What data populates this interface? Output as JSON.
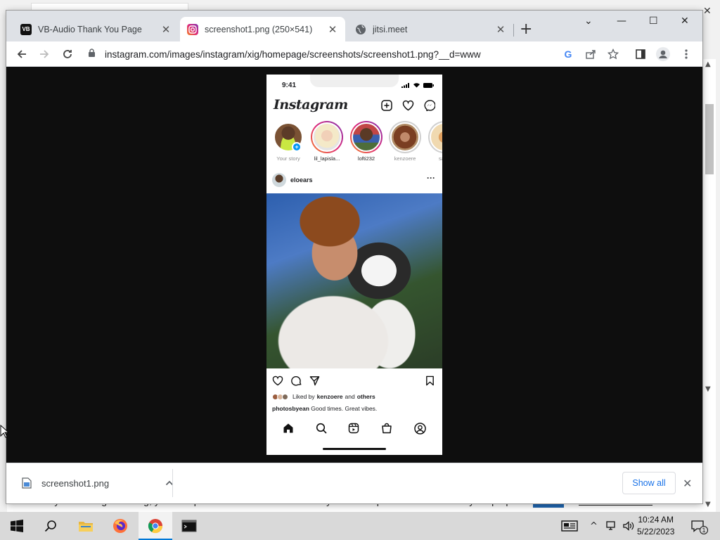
{
  "background": {
    "cookie_text": "By continuing browsing, you accept cookies we use to enhance your site experience and for analytics purposes.",
    "ok_label": "OK",
    "more_info_label": "More information"
  },
  "browser": {
    "tabs": [
      {
        "title": "VB-Audio Thank You Page",
        "icon": "vb-audio-icon",
        "active": false
      },
      {
        "title": "screenshot1.png (250×541)",
        "icon": "instagram-icon",
        "active": true
      },
      {
        "title": "jitsi.meet",
        "icon": "globe-icon",
        "active": false
      }
    ],
    "url": "instagram.com/images/instagram/xig/homepage/screenshots/screenshot1.png?__d=www"
  },
  "phone": {
    "time": "9:41",
    "logo": "Instagram",
    "stories": [
      {
        "name": "Your story",
        "own": true
      },
      {
        "name": "lil_lapisla...",
        "own": false
      },
      {
        "name": "lofti232",
        "own": false
      },
      {
        "name": "kenzoere",
        "own": false
      },
      {
        "name": "sapp",
        "own": false
      }
    ],
    "post": {
      "username": "eloears",
      "likes_prefix": "Liked by",
      "likes_user": "kenzoere",
      "likes_and": "and",
      "likes_others": "others",
      "caption_user": "photosbyean",
      "caption_text": "Good times. Great vibes."
    }
  },
  "downloads": {
    "file_name": "screenshot1.png",
    "show_all_label": "Show all"
  },
  "taskbar": {
    "time": "10:24 AM",
    "date": "5/22/2023",
    "notification_count": "1"
  },
  "colors": {
    "chrome_tab_bar": "#dee1e6",
    "link_blue": "#1a73e8",
    "instagram_blue": "#0095f6",
    "viewer_bg": "#0e0e0e"
  }
}
